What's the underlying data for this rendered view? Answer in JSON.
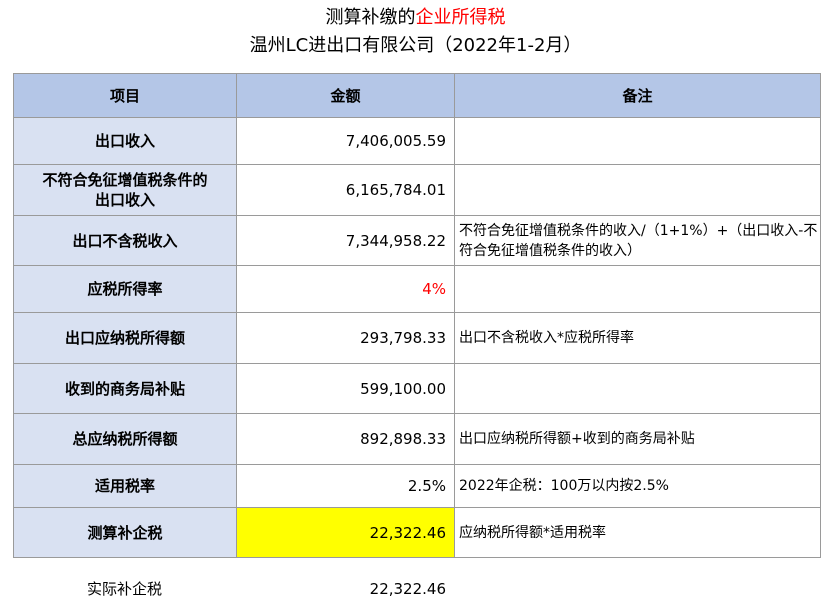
{
  "title": {
    "line1_prefix": "测算补缴的",
    "line1_highlight": "企业所得税",
    "line2": "温州LC进出口有限公司（2022年1-2月）"
  },
  "table": {
    "headers": [
      "项目",
      "金额",
      "备注"
    ],
    "rows": [
      {
        "label": "出口收入",
        "amount": "7,406,005.59",
        "note": ""
      },
      {
        "label": "不符合免征增值税条件的出口收入",
        "amount": "6,165,784.01",
        "note": ""
      },
      {
        "label": "出口不含税收入",
        "amount": "7,344,958.22",
        "note": "不符合免征增值税条件的收入/（1+1%）+（出口收入-不符合免征增值税条件的收入）"
      },
      {
        "label": "应税所得率",
        "amount": "4%",
        "note": ""
      },
      {
        "label": "出口应纳税所得额",
        "amount": "293,798.33",
        "note": "出口不含税收入*应税所得率"
      },
      {
        "label": "收到的商务局补贴",
        "amount": "599,100.00",
        "note": ""
      },
      {
        "label": "总应纳税所得额",
        "amount": "892,898.33",
        "note": "出口应纳税所得额+收到的商务局补贴"
      },
      {
        "label": "适用税率",
        "amount": "2.5%",
        "note": "2022年企税：100万以内按2.5%"
      },
      {
        "label": "测算补企税",
        "amount": "22,322.46",
        "note": "应纳税所得额*适用税率"
      }
    ]
  },
  "footer": {
    "label": "实际补企税",
    "amount": "22,322.46"
  },
  "colors": {
    "header_bg": "#b4c6e7",
    "label_bg": "#d9e1f2",
    "highlight_yellow": "#ffff00",
    "red_text": "#ff0000"
  }
}
